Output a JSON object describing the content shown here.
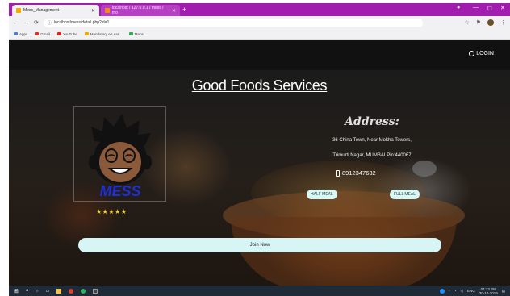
{
  "browser": {
    "tabs": [
      {
        "title": "Mess_Management",
        "active": true
      },
      {
        "title": "localhost / 127.0.0.1 / mess / mo",
        "active": false
      }
    ],
    "new_tab_label": "+",
    "window_controls": {
      "minimize": "—",
      "maximize": "◻",
      "close": "✕"
    },
    "nav": {
      "back": "←",
      "forward": "→",
      "reload": "⟳"
    },
    "url": "localhost/mess/detail.php?id=1",
    "bookmarks": [
      {
        "label": "Apps",
        "color": "#4a7bd1"
      },
      {
        "label": "Gmail",
        "color": "#d93025"
      },
      {
        "label": "YouTube",
        "color": "#e62117"
      },
      {
        "label": "Mandatory e-Lear...",
        "color": "#f2a900"
      },
      {
        "label": "Maps",
        "color": "#34a853"
      }
    ]
  },
  "page": {
    "login_label": "LOGIN",
    "title": "Good Foods Services",
    "logo_text": "MESS",
    "rating": "★★★★★",
    "address_heading": "Address:",
    "address_line1": "36 China Town, Near Mokha Towers,",
    "address_line2": "Trimurti Nagar, MUMBAI Pin:440067",
    "phone": "8912347632",
    "half_meal_label": "HALF MEAL",
    "full_meal_label": "FULL MEAL",
    "join_label": "Join Now"
  },
  "taskbar": {
    "tray_lang": "ENG",
    "time": "04:33 PM",
    "date": "30-10-2019"
  },
  "colors": {
    "tabstrip": "#a21caf",
    "button_bg": "#d6f5f4",
    "star": "#f5d33a",
    "logo_text": "#1e2fd6"
  }
}
